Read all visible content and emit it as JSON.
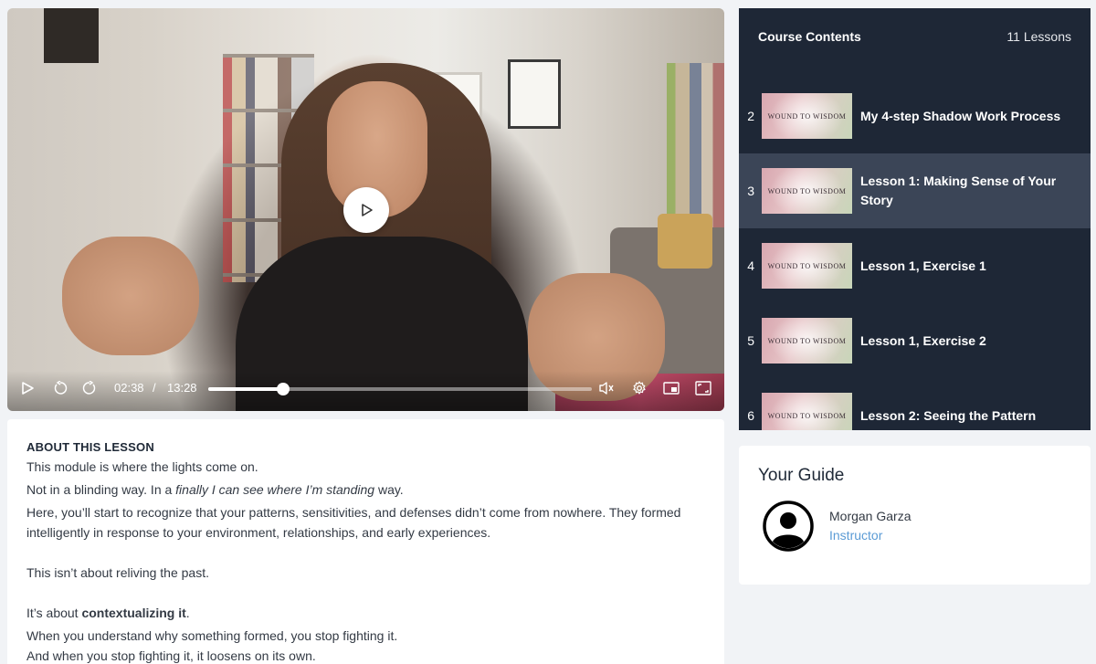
{
  "video": {
    "current_time": "02:38",
    "separator": "/",
    "duration": "13:28",
    "progress_fraction": 0.196
  },
  "course_contents": {
    "title": "Course Contents",
    "lesson_count": "11 Lessons",
    "lessons": [
      {
        "number": "2",
        "title": "My 4-step Shadow Work Process",
        "thumb_text": "WOUND TO WISDOM",
        "active": false
      },
      {
        "number": "3",
        "title": "Lesson 1: Making Sense of Your Story",
        "thumb_text": "WOUND TO WISDOM",
        "active": true
      },
      {
        "number": "4",
        "title": "Lesson 1, Exercise 1",
        "thumb_text": "WOUND TO WISDOM",
        "active": false
      },
      {
        "number": "5",
        "title": "Lesson 1, Exercise 2",
        "thumb_text": "WOUND TO WISDOM",
        "active": false
      },
      {
        "number": "6",
        "title": "Lesson 2: Seeing the Pattern",
        "thumb_text": "WOUND TO WISDOM",
        "active": false
      }
    ]
  },
  "about": {
    "heading": "ABOUT THIS LESSON",
    "line1": "This module is where the lights come on.",
    "line2_pre": "Not in a blinding way. In a ",
    "line2_em": "finally I can see where I’m standing",
    "line2_post": " way.",
    "line3": "Here, you’ll start to recognize that your patterns, sensitivities, and defenses didn’t come from nowhere. They formed intelligently in response to your environment, relationships, and early experiences.",
    "line4": "This isn’t about reliving the past.",
    "line5_pre": "It’s about ",
    "line5_bold": "contextualizing it",
    "line5_post": ".",
    "line6": "When you understand why something formed, you stop fighting it.",
    "line7": "And when you stop fighting it, it loosens on its own."
  },
  "guide": {
    "heading": "Your Guide",
    "name": "Morgan Garza",
    "role": "Instructor"
  },
  "colors": {
    "sidebar_bg": "#1e2736",
    "active_row": "#3b4557",
    "role_link": "#5b9bd5",
    "page_bg": "#f1f3f6"
  }
}
